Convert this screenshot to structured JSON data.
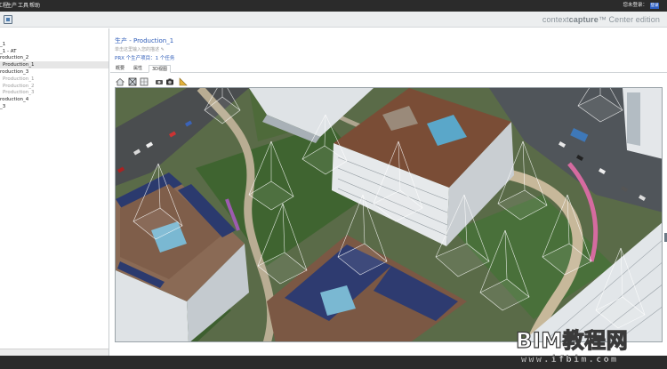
{
  "menubar": {
    "items": [
      "工程",
      "生产",
      "工具",
      "帮助"
    ],
    "login_label": "您未登录：",
    "login_badge": "登录"
  },
  "toolbar": {
    "brand_light": "context",
    "brand_bold": "capture",
    "brand_suffix": "™  Center edition"
  },
  "sidebar": {
    "items": [
      {
        "label": "_1"
      },
      {
        "label": "_1 - AT"
      },
      {
        "label": "roduction_2"
      },
      {
        "label": "Production_1",
        "selected": true
      },
      {
        "label": "roduction_3"
      },
      {
        "label": "Production_1",
        "dim": true
      },
      {
        "label": "Production_2",
        "dim": true
      },
      {
        "label": "Production_3",
        "dim": true
      },
      {
        "label": "roduction_4"
      },
      {
        "label": "_3"
      }
    ]
  },
  "main": {
    "title": "生产 - Production_1",
    "description": "单击这里输入您的描述 ✎",
    "summary": "PRX 个生产项目：1 个任务",
    "tabs": [
      {
        "label": "概要"
      },
      {
        "label": "属性"
      },
      {
        "label": "3D视图",
        "active": true
      }
    ],
    "view_tools": [
      "home-icon",
      "wireframe-icon",
      "grid-icon",
      "camera-icon",
      "snapshot-icon",
      "measure-icon"
    ]
  },
  "watermark": {
    "title": "BIM教程网",
    "url": "www.ifbim.com"
  },
  "colors": {
    "menubar_bg": "#2b2b2b",
    "accent_blue": "#2e5cb8",
    "toolbar_bg": "#eceeef"
  }
}
